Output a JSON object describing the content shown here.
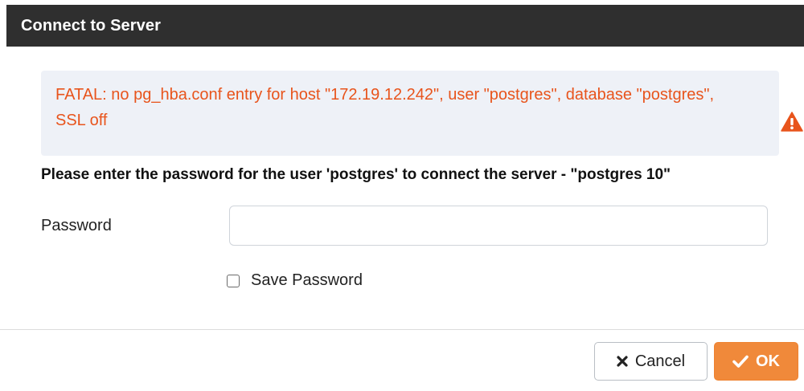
{
  "dialog": {
    "title": "Connect to Server"
  },
  "alert": {
    "message": "FATAL: no pg_hba.conf entry for host \"172.19.12.242\", user \"postgres\", database \"postgres\", SSL off",
    "icon": "warning-triangle-icon",
    "color": "#e8541c"
  },
  "prompt": {
    "text": "Please enter the password for the user 'postgres' to connect the server - \"postgres 10\""
  },
  "password": {
    "label": "Password",
    "value": "",
    "placeholder": ""
  },
  "save_password": {
    "label": "Save Password",
    "checked": false
  },
  "buttons": {
    "cancel_label": "Cancel",
    "cancel_icon": "x-icon",
    "ok_label": "OK",
    "ok_icon": "checkmark-icon",
    "ok_color": "#f0893a"
  }
}
